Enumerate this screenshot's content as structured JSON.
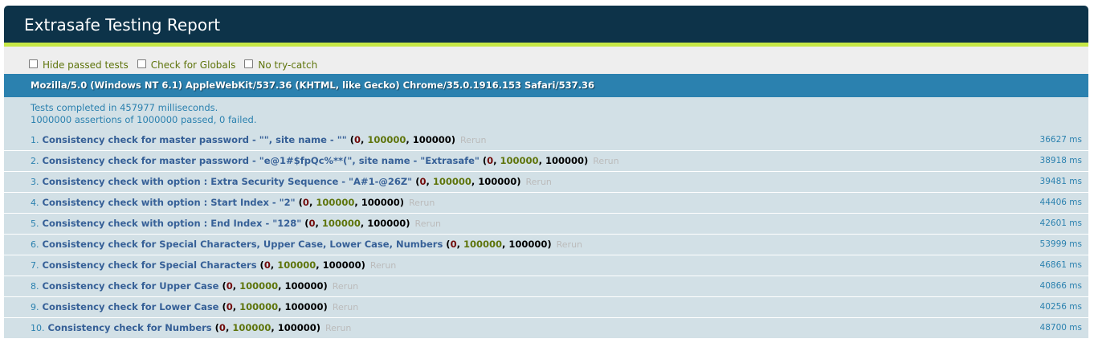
{
  "header": {
    "title": "Extrasafe Testing Report"
  },
  "toolbar": {
    "options": [
      {
        "label": "Hide passed tests"
      },
      {
        "label": "Check for Globals"
      },
      {
        "label": "No try-catch"
      }
    ]
  },
  "user_agent": "Mozilla/5.0 (Windows NT 6.1) AppleWebKit/537.36 (KHTML, like Gecko) Chrome/35.0.1916.153 Safari/537.36",
  "result": {
    "line1": "Tests completed in 457977 milliseconds.",
    "line2": "1000000 assertions of 1000000 passed, 0 failed."
  },
  "tests": [
    {
      "num": "1.",
      "name": "Consistency check for master password - \"\", site name - \"\"",
      "failed": "0",
      "passed": "100000",
      "total": "100000",
      "rerun": "Rerun",
      "runtime": "36627 ms"
    },
    {
      "num": "2.",
      "name": "Consistency check for master password - \"e@1#$fpQc%**(\", site name - \"Extrasafe\"",
      "failed": "0",
      "passed": "100000",
      "total": "100000",
      "rerun": "Rerun",
      "runtime": "38918 ms"
    },
    {
      "num": "3.",
      "name": "Consistency check with option : Extra Security Sequence - \"A#1-@26Z\"",
      "failed": "0",
      "passed": "100000",
      "total": "100000",
      "rerun": "Rerun",
      "runtime": "39481 ms"
    },
    {
      "num": "4.",
      "name": "Consistency check with option : Start Index - \"2\"",
      "failed": "0",
      "passed": "100000",
      "total": "100000",
      "rerun": "Rerun",
      "runtime": "44406 ms"
    },
    {
      "num": "5.",
      "name": "Consistency check with option : End Index - \"128\"",
      "failed": "0",
      "passed": "100000",
      "total": "100000",
      "rerun": "Rerun",
      "runtime": "42601 ms"
    },
    {
      "num": "6.",
      "name": "Consistency check for Special Characters, Upper Case, Lower Case, Numbers",
      "failed": "0",
      "passed": "100000",
      "total": "100000",
      "rerun": "Rerun",
      "runtime": "53999 ms"
    },
    {
      "num": "7.",
      "name": "Consistency check for Special Characters",
      "failed": "0",
      "passed": "100000",
      "total": "100000",
      "rerun": "Rerun",
      "runtime": "46861 ms"
    },
    {
      "num": "8.",
      "name": "Consistency check for Upper Case",
      "failed": "0",
      "passed": "100000",
      "total": "100000",
      "rerun": "Rerun",
      "runtime": "40866 ms"
    },
    {
      "num": "9.",
      "name": "Consistency check for Lower Case",
      "failed": "0",
      "passed": "100000",
      "total": "100000",
      "rerun": "Rerun",
      "runtime": "40256 ms"
    },
    {
      "num": "10.",
      "name": "Consistency check for Numbers",
      "failed": "0",
      "passed": "100000",
      "total": "100000",
      "rerun": "Rerun",
      "runtime": "48700 ms"
    }
  ]
}
